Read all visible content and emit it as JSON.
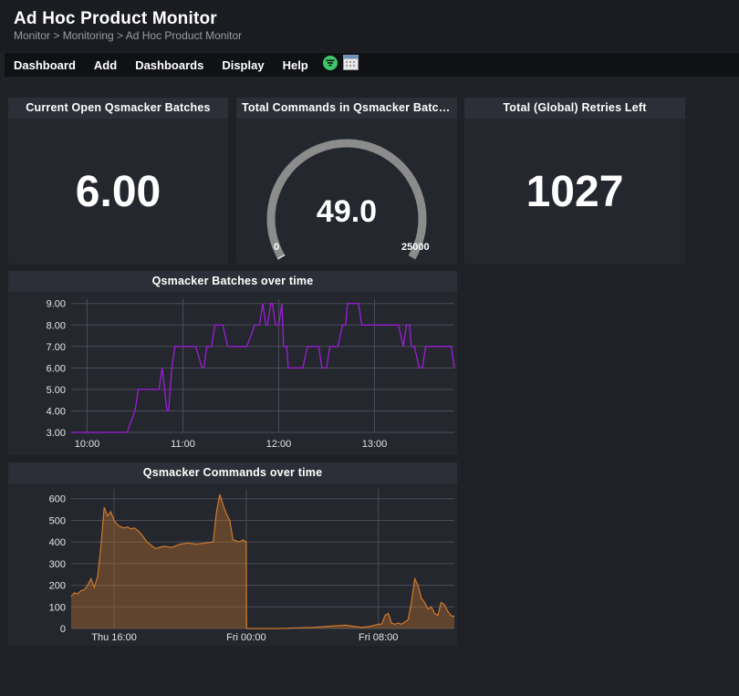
{
  "header": {
    "title": "Ad Hoc Product Monitor",
    "breadcrumb": "Monitor > Monitoring > Ad Hoc Product Monitor"
  },
  "menu": {
    "items": [
      "Dashboard",
      "Add",
      "Dashboards",
      "Display",
      "Help"
    ],
    "icons": [
      "filter-circle-icon",
      "calendar-icon"
    ],
    "filter_icon_color": "#3ec76a"
  },
  "panels": {
    "open_batches": {
      "title": "Current Open Qsmacker Batches",
      "value": "6.00"
    },
    "total_commands": {
      "title": "Total Commands in Qsmacker Batches",
      "value": "49.0",
      "min": "0",
      "max": "25000",
      "fraction": 0.00196
    },
    "retries": {
      "title": "Total (Global) Retries Left",
      "value": "1027"
    },
    "batches_chart": {
      "title": "Qsmacker Batches over time"
    },
    "commands_chart": {
      "title": "Qsmacker Commands over time"
    }
  },
  "chart_data": [
    {
      "type": "line",
      "title": "Qsmacker Batches over time",
      "color": "#9b1ed8",
      "x_tick_labels": [
        "10:00",
        "11:00",
        "12:00",
        "13:00"
      ],
      "y_tick_labels": [
        "9.00",
        "8.00",
        "7.00",
        "6.00",
        "5.00",
        "4.00",
        "3.00"
      ],
      "ylim": [
        3,
        9.2
      ],
      "xlim": [
        "09:50",
        "13:50"
      ],
      "x": [
        "09:50",
        "10:25",
        "10:30",
        "10:32",
        "10:35",
        "10:40",
        "10:45",
        "10:47",
        "10:50",
        "10:51",
        "10:53",
        "10:55",
        "10:58",
        "11:00",
        "11:08",
        "11:12",
        "11:13",
        "11:15",
        "11:18",
        "11:20",
        "11:25",
        "11:28",
        "11:32",
        "11:40",
        "11:45",
        "11:48",
        "11:50",
        "11:52",
        "11:53",
        "11:55",
        "11:56",
        "11:58",
        "12:00",
        "12:02",
        "12:03",
        "12:05",
        "12:06",
        "12:10",
        "12:15",
        "12:18",
        "12:25",
        "12:27",
        "12:30",
        "12:32",
        "12:35",
        "12:37",
        "12:40",
        "12:42",
        "12:43",
        "12:45",
        "12:50",
        "12:52",
        "12:55",
        "13:00",
        "13:05",
        "13:10",
        "13:15",
        "13:18",
        "13:20",
        "13:22",
        "13:23",
        "13:25",
        "13:28",
        "13:30",
        "13:32",
        "13:35",
        "13:40",
        "13:48",
        "13:50"
      ],
      "y": [
        3,
        3,
        4,
        5,
        5,
        5,
        5,
        6,
        4,
        4,
        6,
        7,
        7,
        7,
        7,
        6,
        6,
        7,
        7,
        8,
        8,
        7,
        7,
        7,
        8,
        8,
        9,
        8,
        8,
        9,
        9,
        8,
        8,
        9,
        7,
        7,
        6,
        6,
        6,
        7,
        7,
        6,
        6,
        7,
        7,
        7,
        8,
        8,
        9,
        9,
        9,
        8,
        8,
        8,
        8,
        8,
        8,
        7,
        8,
        8,
        7,
        7,
        6,
        6,
        7,
        7,
        7,
        7,
        6
      ]
    },
    {
      "type": "area",
      "title": "Qsmacker Commands over time",
      "color": "#d07a2c",
      "x_tick_labels": [
        "Thu 16:00",
        "Fri 00:00",
        "Fri 08:00"
      ],
      "y_tick_labels": [
        "600",
        "500",
        "400",
        "300",
        "200",
        "100",
        "0"
      ],
      "ylim": [
        0,
        620
      ],
      "x_hours": [
        13.4,
        13.6,
        13.8,
        14,
        14.2,
        14.4,
        14.6,
        14.8,
        15,
        15.2,
        15.4,
        15.6,
        15.8,
        16,
        16.2,
        16.4,
        16.6,
        16.8,
        17,
        17.2,
        17.4,
        17.6,
        17.8,
        18,
        18.5,
        19,
        19.5,
        20,
        20.5,
        21,
        21.5,
        22,
        22.2,
        22.4,
        22.6,
        22.8,
        23,
        23.2,
        23.4,
        23.6,
        23.8,
        24,
        24.02,
        26,
        28,
        30,
        30.5,
        31,
        31.5,
        32,
        32.2,
        32.4,
        32.6,
        32.8,
        33,
        33.2,
        33.4,
        33.6,
        33.8,
        34,
        34.2,
        34.4,
        34.6,
        34.8,
        35,
        35.2,
        35.4,
        35.6,
        35.8,
        36,
        36.2,
        36.4,
        36.6
      ],
      "y": [
        150,
        165,
        160,
        175,
        180,
        200,
        230,
        190,
        240,
        380,
        560,
        520,
        540,
        500,
        480,
        470,
        465,
        470,
        460,
        465,
        455,
        440,
        420,
        400,
        370,
        380,
        375,
        390,
        395,
        390,
        395,
        400,
        540,
        620,
        570,
        530,
        500,
        410,
        405,
        400,
        410,
        400,
        0,
        0,
        5,
        15,
        10,
        5,
        10,
        20,
        20,
        60,
        70,
        25,
        20,
        25,
        20,
        30,
        40,
        120,
        230,
        200,
        140,
        120,
        90,
        100,
        70,
        60,
        120,
        110,
        80,
        60,
        55
      ]
    }
  ]
}
